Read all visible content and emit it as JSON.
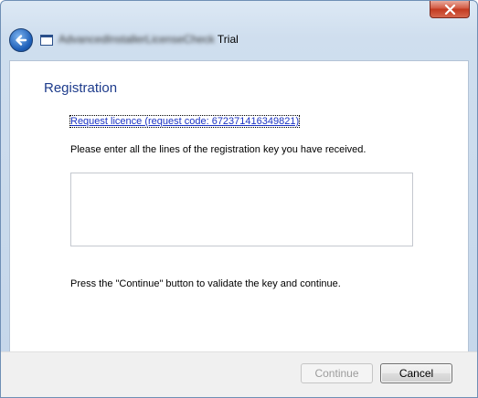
{
  "window": {
    "title_app": "AdvancedInstallerLicenseCheck",
    "title_suffix": "Trial"
  },
  "page": {
    "heading": "Registration",
    "request_link": "Request licence (request code: 672371416349821)",
    "instructions": "Please enter all the lines of the registration key you have received.",
    "key_value": "",
    "hint": "Press the \"Continue\" button to validate the key and continue."
  },
  "buttons": {
    "continue_label": "Continue",
    "cancel_label": "Cancel"
  },
  "icons": {
    "close": "close-icon",
    "back": "back-arrow-icon",
    "app": "window-icon"
  },
  "colors": {
    "heading": "#1e3c8c",
    "link": "#1c34c4",
    "close_button": "#c2391f"
  }
}
